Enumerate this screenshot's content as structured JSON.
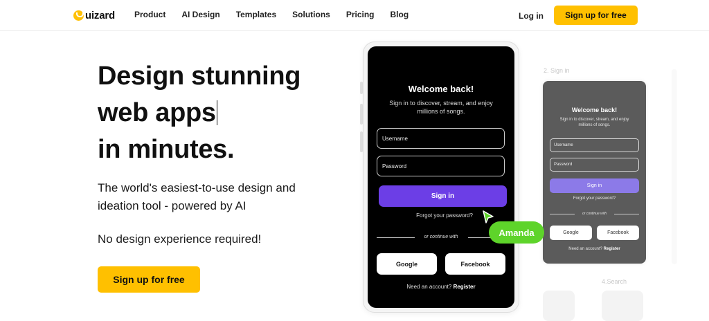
{
  "nav": {
    "logo_text": "uizard",
    "links": [
      "Product",
      "AI Design",
      "Templates",
      "Solutions",
      "Pricing",
      "Blog"
    ],
    "login": "Log in",
    "cta": "Sign up for free"
  },
  "hero": {
    "headline": [
      "Design stunning",
      "web apps",
      "in minutes."
    ],
    "subtitle": "The world's easiest-to-use design and ideation tool - powered by AI",
    "note": "No design experience required!",
    "cta": "Sign up for free"
  },
  "phone": {
    "title": "Welcome back!",
    "subtitle": "Sign in to discover, stream, and enjoy millions of songs.",
    "username_placeholder": "Username",
    "password_placeholder": "Password",
    "signin": "Sign in",
    "forgot": "Forgot your password?",
    "continue_with": "or continue with",
    "google": "Google",
    "facebook": "Facebook",
    "register_prompt": "Need an account?",
    "register_link": "Register"
  },
  "collaborator": {
    "name": "Amanda",
    "color": "#5ed42a"
  },
  "preview": {
    "step_signin": "2. Sign in",
    "step_search": "4.Search",
    "title": "Welcome back!",
    "subtitle": "Sign in to discover, stream, and enjoy millions of songs.",
    "username_placeholder": "Username",
    "password_placeholder": "Password",
    "signin": "Sign in",
    "forgot": "Forgot your password?",
    "continue_with": "or continue with",
    "google": "Google",
    "facebook": "Facebook",
    "register_prompt": "Need an account?",
    "register_link": "Register"
  },
  "colors": {
    "brand_yellow": "#ffc000",
    "signin_purple": "#6c3ee6",
    "phone_bg": "#000000"
  },
  "icons": {
    "logo": "uizard-logo-icon",
    "cursor": "pointer-cursor-icon"
  }
}
